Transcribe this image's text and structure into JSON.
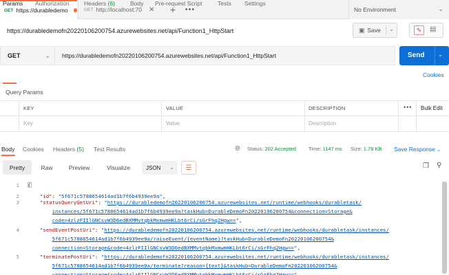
{
  "tabs": [
    {
      "method": "GET",
      "title": "https://durabledemo",
      "active": true
    },
    {
      "method": "GET",
      "title": "http://localhost:70",
      "active": false
    }
  ],
  "environment": {
    "selected": "No Environment"
  },
  "request": {
    "name": "https://durabledemofn20220106200754.azurewebsites.net/api/Function1_HttpStart",
    "method": "GET",
    "url": "https://durabledemofn20220106200754.azurewebsites.net/api/Function1_HttpStart",
    "save_label": "Save",
    "send_label": "Send"
  },
  "request_tabs": {
    "params": "Params",
    "authorization": "Authorization",
    "headers": "Headers",
    "headers_count": "(6)",
    "body": "Body",
    "pre_request_script": "Pre-request Script",
    "tests": "Tests",
    "settings": "Settings",
    "cookies": "Cookies"
  },
  "query_params": {
    "title": "Query Params",
    "headers": {
      "key": "KEY",
      "value": "VALUE",
      "description": "DESCRIPTION",
      "bulk_edit": "Bulk Edit"
    },
    "placeholders": {
      "key": "Key",
      "value": "Value",
      "description": "Description"
    }
  },
  "response": {
    "tabs": {
      "body": "Body",
      "cookies": "Cookies",
      "headers": "Headers",
      "headers_count": "(5)",
      "test_results": "Test Results"
    },
    "status_label": "Status:",
    "status_value": "202 Accepted",
    "time_label": "Time:",
    "time_value": "1147 ms",
    "size_label": "Size:",
    "size_value": "1.78 KB",
    "save_response": "Save Response",
    "formats": {
      "pretty": "Pretty",
      "raw": "Raw",
      "preview": "Preview",
      "visualize": "Visualize"
    },
    "language": "JSON"
  },
  "code_lines": [
    {
      "no": "1",
      "parts": [
        {
          "c": "",
          "t": "{"
        }
      ]
    },
    {
      "no": "2",
      "parts": [
        {
          "c": "",
          "t": "    "
        },
        {
          "c": "key",
          "t": "\"id\""
        },
        {
          "c": "",
          "t": ": "
        },
        {
          "c": "str",
          "t": "\"5f671c5788654614ad1b7f6b4939ee9a\""
        },
        {
          "c": "",
          "t": ","
        }
      ]
    },
    {
      "no": "3",
      "parts": [
        {
          "c": "",
          "t": "    "
        },
        {
          "c": "key",
          "t": "\"statusQueryGetUri\""
        },
        {
          "c": "",
          "t": ": "
        },
        {
          "c": "str",
          "t": "\""
        },
        {
          "c": "url",
          "t": "https://durabledemofn20220106200754.azurewebsites.net/runtime/webhooks/durabletask/"
        }
      ]
    },
    {
      "no": "",
      "parts": [
        {
          "c": "",
          "t": "        "
        },
        {
          "c": "url",
          "t": "instances/5f671c5788654614ad1b7f6b4939ee9a?taskHub=DurableDemoFn20220106200754&connection=Storage&"
        }
      ]
    },
    {
      "no": "",
      "parts": [
        {
          "c": "",
          "t": "        "
        },
        {
          "c": "url",
          "t": "code=4zlzFIIlGNCsvW3D6edBXMMvtqbkMxmwmHKLbt6rCi/sGrFhq2Hgw=="
        },
        {
          "c": "str",
          "t": "\""
        },
        {
          "c": "",
          "t": ","
        }
      ]
    },
    {
      "no": "4",
      "parts": [
        {
          "c": "",
          "t": "    "
        },
        {
          "c": "key",
          "t": "\"sendEventPostUri\""
        },
        {
          "c": "",
          "t": ": "
        },
        {
          "c": "str",
          "t": "\""
        },
        {
          "c": "url",
          "t": "https://durabledemofn20220106200754.azurewebsites.net/runtime/webhooks/durabletask/instances/"
        }
      ]
    },
    {
      "no": "",
      "parts": [
        {
          "c": "",
          "t": "        "
        },
        {
          "c": "url",
          "t": "5f671c5788654614ad1b7f6b4939ee9a/raiseEvent/{eventName}?taskHub=DurableDemoFn20220106200754&"
        }
      ]
    },
    {
      "no": "",
      "parts": [
        {
          "c": "",
          "t": "        "
        },
        {
          "c": "url",
          "t": "connection=Storage&code=4zlzFIIlGNCsvW3D6edBXMMvtqbkMxmwmHKLbt6rCi/sGrFhq2Hgw=="
        },
        {
          "c": "str",
          "t": "\""
        },
        {
          "c": "",
          "t": ","
        }
      ]
    },
    {
      "no": "5",
      "parts": [
        {
          "c": "",
          "t": "    "
        },
        {
          "c": "key",
          "t": "\"terminatePostUri\""
        },
        {
          "c": "",
          "t": ": "
        },
        {
          "c": "str",
          "t": "\""
        },
        {
          "c": "url",
          "t": "https://durabledemofn20220106200754.azurewebsites.net/runtime/webhooks/durabletask/instances/"
        }
      ]
    },
    {
      "no": "",
      "parts": [
        {
          "c": "",
          "t": "        "
        },
        {
          "c": "url",
          "t": "5f671c5788654614ad1b7f6b4939ee9a/terminate?reason={text}&taskHub=DurableDemoFn20220106200754&"
        }
      ]
    },
    {
      "no": "",
      "parts": [
        {
          "c": "",
          "t": "        "
        },
        {
          "c": "url",
          "t": "connection=Storage&code=4zlzFIIlGNCsvW3D6edBXMMvtqbkMxmwmHKLbt6rCi/sGrFhq2Hgw=="
        },
        {
          "c": "str",
          "t": "\""
        },
        {
          "c": "",
          "t": ","
        }
      ]
    }
  ],
  "colors": {
    "accent": "#ff6c37",
    "send": "#0d6fd6",
    "status_ok": "#0f8a3e"
  },
  "icons": [
    "close-icon",
    "add-tab-icon",
    "more-icon",
    "chevron-down-icon",
    "save-icon",
    "pencil-icon",
    "document-icon",
    "globe-icon",
    "wrap-icon",
    "copy-icon",
    "search-icon"
  ]
}
